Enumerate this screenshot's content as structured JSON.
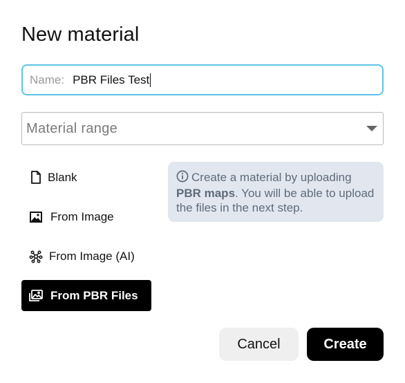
{
  "dialog": {
    "title": "New material"
  },
  "name_field": {
    "prefix": "Name:",
    "value": "PBR Files Test"
  },
  "material_range": {
    "placeholder": "Material range"
  },
  "options": [
    {
      "label": "Blank",
      "icon": "file-icon",
      "selected": false
    },
    {
      "label": "From Image",
      "icon": "image-icon",
      "selected": false
    },
    {
      "label": "From Image (AI)",
      "icon": "ai-nodes-icon",
      "selected": false
    },
    {
      "label": "From PBR Files",
      "icon": "images-stack-icon",
      "selected": true
    }
  ],
  "info_box": {
    "icon": "info-icon",
    "text_before": "Create a material by uploading ",
    "text_bold": "PBR maps",
    "text_after": ". You will be able to upload the files in the next step."
  },
  "buttons": {
    "cancel": "Cancel",
    "create": "Create"
  },
  "colors": {
    "focus_border": "#5cc3e6",
    "selected_bg": "#000000",
    "info_bg": "#e2e7ef",
    "info_text": "#5f6b7a",
    "cancel_bg": "#efefef"
  }
}
